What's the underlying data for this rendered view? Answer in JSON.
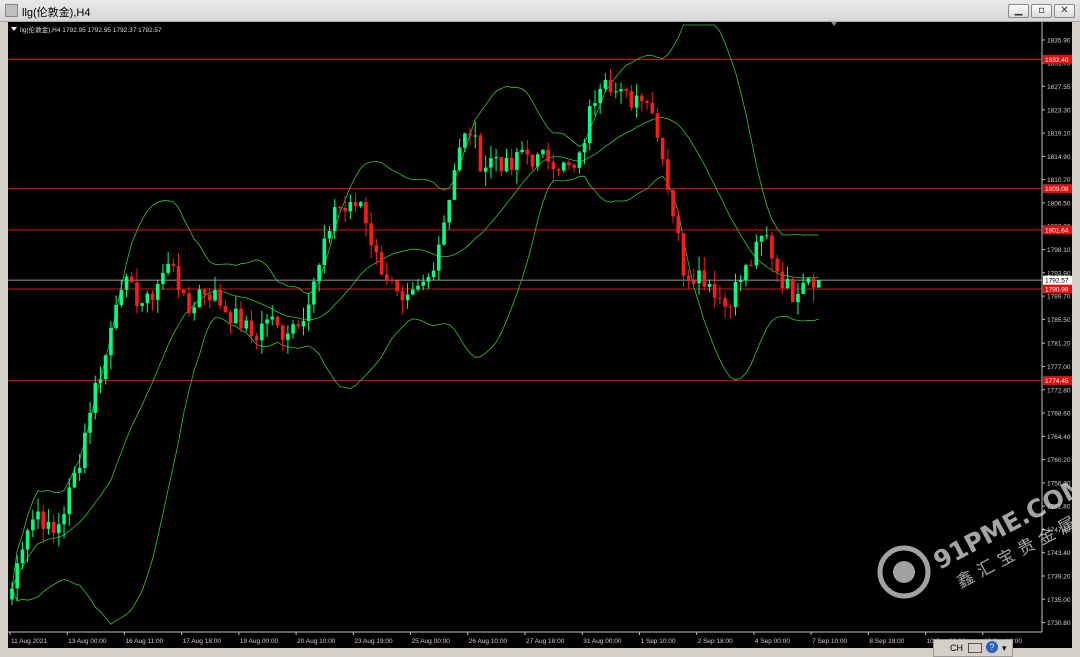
{
  "window": {
    "title": "llg(伦敦金),H4"
  },
  "chart_header": "llg(伦敦金),H4  1792.95 1792.95 1792.37 1792.57",
  "tray": {
    "input_label": "CH"
  },
  "watermark": {
    "domain": "91PME.COM",
    "cn": "鑫汇宝贵金属"
  },
  "colors": {
    "bull": "#00ff7f",
    "bear": "#ff1a1a",
    "band": "#32c832",
    "level": "#e01010",
    "axis": "#c0c0c0",
    "current": "#c8c8c8"
  },
  "chart_data": {
    "type": "candlestick",
    "title": "llg(伦敦金),H4",
    "ylim": [
      1729.1,
      1838.6
    ],
    "y_ticks": [
      1835.9,
      1831.7,
      1827.55,
      1823.3,
      1819.1,
      1814.9,
      1810.7,
      1806.5,
      1802.3,
      1798.1,
      1793.9,
      1789.7,
      1785.5,
      1781.2,
      1777.0,
      1772.8,
      1768.6,
      1764.4,
      1760.2,
      1756.0,
      1751.8,
      1747.6,
      1743.4,
      1739.2,
      1735.0,
      1730.8
    ],
    "x_labels": [
      "11 Aug 2021",
      "13 Aug 00:00",
      "16 Aug 11:00",
      "17 Aug 18:00",
      "19 Aug 00:00",
      "20 Aug 10:00",
      "23 Aug 19:00",
      "25 Aug 00:00",
      "26 Aug 10:00",
      "27 Aug 18:00",
      "31 Aug 00:00",
      "1 Sep 10:00",
      "2 Sep 18:00",
      "4 Sep 00:00",
      "7 Sep 10:00",
      "8 Sep 18:00",
      "10 Sep 00:00",
      "13 Sep 11:00"
    ],
    "levels": [
      {
        "price": 1832.4,
        "label": "1832.40"
      },
      {
        "price": 1809.08,
        "label": "1809.08"
      },
      {
        "price": 1801.64,
        "label": "1801.64"
      },
      {
        "price": 1790.98,
        "label": "1790.98"
      },
      {
        "price": 1774.45,
        "label": "1774.45"
      }
    ],
    "current_price": {
      "price": 1792.57,
      "label": "1792.57"
    },
    "close_path": [
      1737,
      1748,
      1751,
      1746,
      1752,
      1760,
      1772,
      1779,
      1793,
      1790,
      1788,
      1793,
      1796,
      1786,
      1791,
      1790,
      1787,
      1785,
      1782,
      1786,
      1783,
      1785,
      1788,
      1796,
      1806,
      1805,
      1807,
      1797,
      1793,
      1787,
      1790,
      1793,
      1802,
      1814,
      1820,
      1813,
      1815,
      1812,
      1816,
      1814,
      1815,
      1813,
      1812,
      1823,
      1831,
      1826,
      1825,
      1827,
      1820,
      1807,
      1794,
      1794,
      1792,
      1788,
      1792,
      1796,
      1801,
      1794,
      1790,
      1794,
      1792.57
    ],
    "candles_count": 156
  }
}
